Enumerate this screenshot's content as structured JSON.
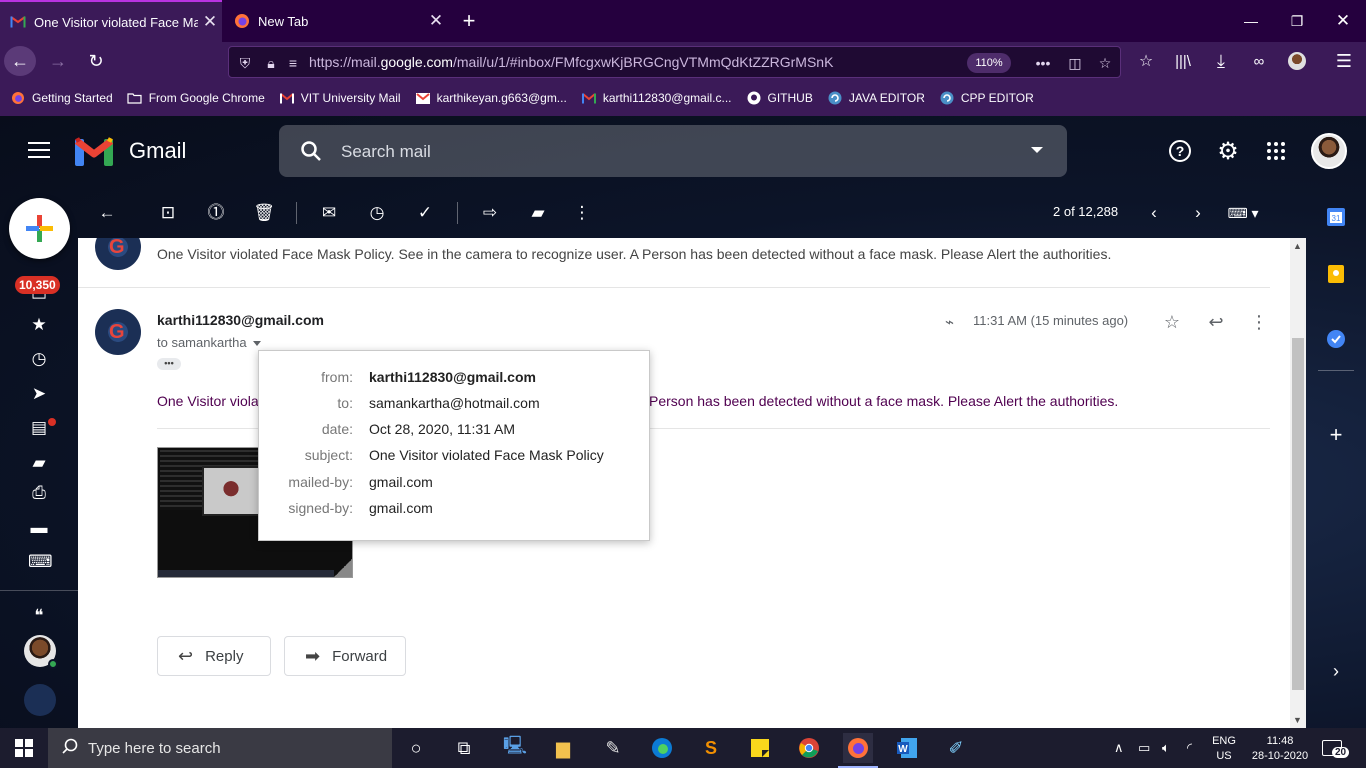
{
  "browser": {
    "tabs": [
      {
        "title": "One Visitor violated Face Mask Policy",
        "favicon": "gmail-icon",
        "active": true
      },
      {
        "title": "New Tab",
        "favicon": "firefox-icon",
        "active": false
      }
    ],
    "url_prefix": "https://mail.",
    "url_domain": "google.com",
    "url_rest": "/mail/u/1/#inbox/FMfcgxwKjBRGCngVTMmQdKtZZRGrMSnK",
    "zoom": "110%",
    "bookmarks": [
      {
        "label": "Getting Started",
        "icon": "firefox-icon"
      },
      {
        "label": "From Google Chrome",
        "icon": "folder-icon"
      },
      {
        "label": "VIT University Mail",
        "icon": "gmail-icon"
      },
      {
        "label": "karthikeyan.g663@gm...",
        "icon": "gmail-icon"
      },
      {
        "label": "karthi112830@gmail.c...",
        "icon": "gmail-icon"
      },
      {
        "label": "GITHUB",
        "icon": "github-icon"
      },
      {
        "label": "JAVA EDITOR",
        "icon": "editor-icon"
      },
      {
        "label": "CPP EDITOR",
        "icon": "editor-icon"
      }
    ]
  },
  "gmail": {
    "brand": "Gmail",
    "search_placeholder": "Search mail",
    "unread_badge": "10,350",
    "pagination": "2 of 12,288",
    "colors": {
      "accent_red": "#d93025",
      "body_text": "#500050"
    }
  },
  "thread": {
    "collapsed_snippet": "One Visitor violated Face Mask Policy. See in the camera to recognize user. A Person has been detected without a face mask. Please Alert the authorities.",
    "message": {
      "sender": "karthi112830@gmail.com",
      "to_line": "to samankartha",
      "time": "11:31 AM (15 minutes ago)",
      "body_left": "One Visitor viola",
      "body_right": "Person has been detected without a face mask. Please Alert the authorities."
    },
    "details": [
      {
        "key": "from:",
        "value": "karthi112830@gmail.com",
        "bold": true
      },
      {
        "key": "to:",
        "value": "samankartha@hotmail.com",
        "bold": false
      },
      {
        "key": "date:",
        "value": "Oct 28, 2020, 11:31 AM",
        "bold": false
      },
      {
        "key": "subject:",
        "value": "One Visitor violated Face Mask Policy",
        "bold": false
      },
      {
        "key": "mailed-by:",
        "value": "gmail.com",
        "bold": false
      },
      {
        "key": "signed-by:",
        "value": "gmail.com",
        "bold": false
      }
    ],
    "reply_label": "Reply",
    "forward_label": "Forward"
  },
  "taskbar": {
    "search_placeholder": "Type here to search",
    "lang_top": "ENG",
    "lang_bottom": "US",
    "time": "11:48",
    "date": "28-10-2020",
    "notifications": "20"
  }
}
